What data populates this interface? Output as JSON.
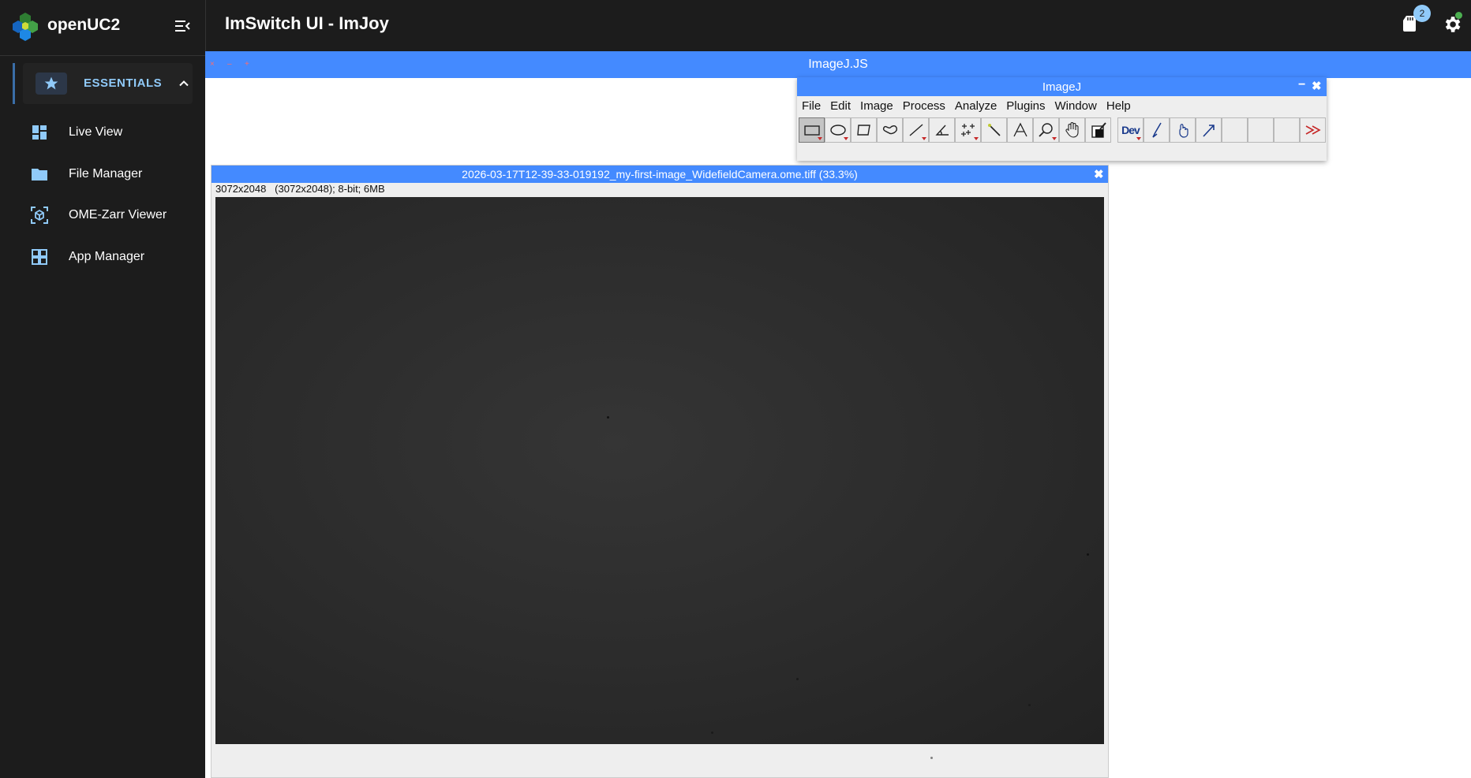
{
  "brand": {
    "name": "openUC2"
  },
  "sidebar": {
    "section": {
      "label": "ESSENTIALS"
    },
    "items": [
      {
        "label": "Live View",
        "icon": "dashboard-icon"
      },
      {
        "label": "File Manager",
        "icon": "folder-icon"
      },
      {
        "label": "OME-Zarr Viewer",
        "icon": "cube-scan-icon"
      },
      {
        "label": "App Manager",
        "icon": "apps-grid-icon"
      }
    ]
  },
  "header": {
    "title": "ImSwitch UI - ImJoy",
    "badge_count": "2",
    "colors": {
      "bar": "#1c1c1c",
      "badge": "#90caf9",
      "status": "#4caf50"
    }
  },
  "imagejs": {
    "title": "ImageJ.JS",
    "accent": "#448aff"
  },
  "imagej": {
    "title": "ImageJ",
    "menus": [
      "File",
      "Edit",
      "Image",
      "Process",
      "Analyze",
      "Plugins",
      "Window",
      "Help"
    ],
    "dev_label": "Dev"
  },
  "image_window": {
    "title": "2026-03-17T12-39-33-019192_my-first-image_WidefieldCamera.ome.tiff (33.3%)",
    "info": "3072x2048   (3072x2048); 8-bit; 6MB"
  }
}
